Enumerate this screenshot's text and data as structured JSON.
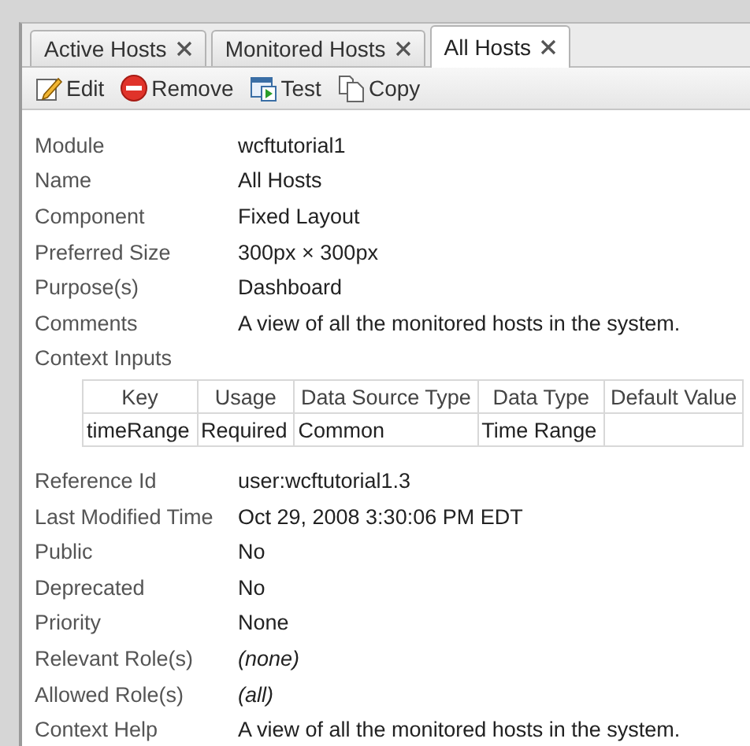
{
  "tabs": [
    {
      "label": "Active Hosts",
      "selected": false
    },
    {
      "label": "Monitored Hosts",
      "selected": false
    },
    {
      "label": "All Hosts",
      "selected": true
    }
  ],
  "toolbar": [
    {
      "kind": "edit",
      "label": "Edit"
    },
    {
      "kind": "remove",
      "label": "Remove"
    },
    {
      "kind": "test",
      "label": "Test"
    },
    {
      "kind": "copy",
      "label": "Copy"
    }
  ],
  "properties": [
    {
      "label": "Module",
      "value": "wcftutorial1",
      "kind": "text"
    },
    {
      "label": "Name",
      "value": "All Hosts",
      "kind": "text"
    },
    {
      "label": "Component",
      "value": "Fixed Layout",
      "kind": "text"
    },
    {
      "label": "Preferred Size",
      "value": "300px × 300px",
      "kind": "text"
    },
    {
      "label": "Purpose(s)",
      "value": "Dashboard",
      "kind": "text"
    },
    {
      "label": "Comments",
      "value": "A view of all the monitored hosts in the system.",
      "kind": "text"
    }
  ],
  "context_inputs": {
    "label": "Context Inputs",
    "columns": [
      "Key",
      "Usage",
      "Data Source Type",
      "Data Type",
      "Default Value"
    ],
    "rows": [
      [
        "timeRange",
        "Required",
        "Common",
        "Time Range",
        ""
      ]
    ]
  },
  "properties_after": [
    {
      "label": "Reference Id",
      "value": "user:wcftutorial1.3",
      "kind": "text"
    },
    {
      "label": "Last Modified Time",
      "value": "Oct 29, 2008 3:30:06 PM EDT",
      "kind": "text"
    },
    {
      "label": "Public",
      "value": "No",
      "kind": "text"
    },
    {
      "label": "Deprecated",
      "value": "No",
      "kind": "text"
    },
    {
      "label": "Priority",
      "value": "None",
      "kind": "text"
    },
    {
      "label": "Relevant Role(s)",
      "value": "(none)",
      "kind": "empty"
    },
    {
      "label": "Allowed Role(s)",
      "value": "(all)",
      "kind": "empty"
    },
    {
      "label": "Context Help",
      "value": "A view of all the monitored hosts in the system.",
      "kind": "text"
    }
  ]
}
